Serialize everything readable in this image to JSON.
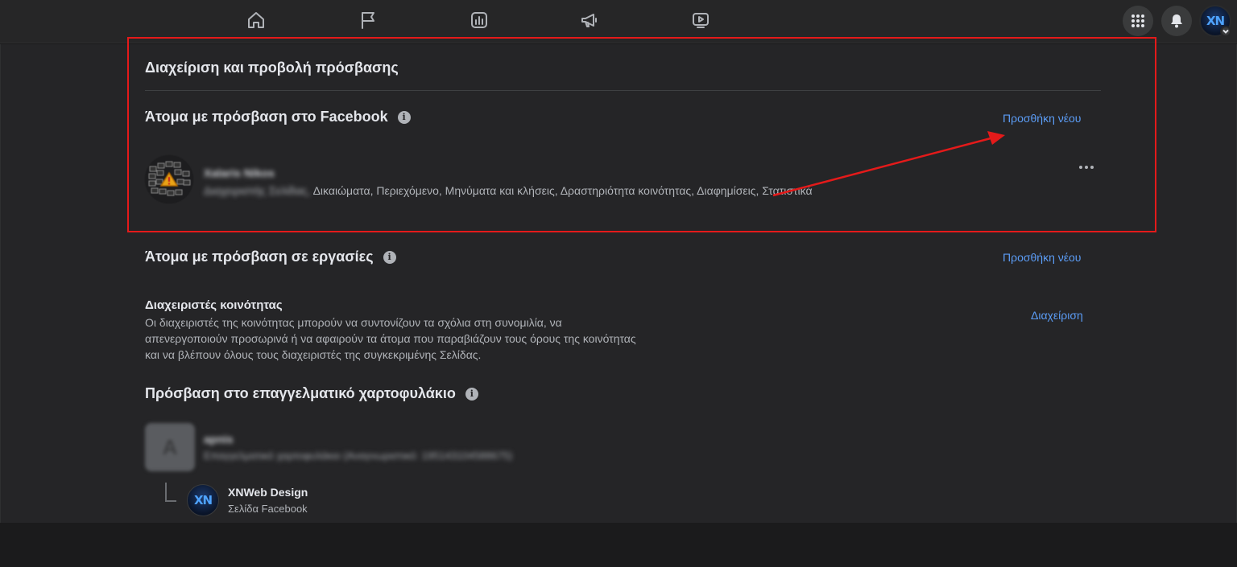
{
  "topbar": {
    "nav": [
      {
        "name": "home-icon"
      },
      {
        "name": "flag-icon"
      },
      {
        "name": "insights-icon"
      },
      {
        "name": "megaphone-icon"
      },
      {
        "name": "video-icon"
      }
    ],
    "menu_icon": "grid-menu-icon",
    "notifications_icon": "bell-icon",
    "profile_logo_text": "XN"
  },
  "access": {
    "title": "Διαχείριση και προβολή πρόσβασης",
    "facebook_access": {
      "title": "Άτομα με πρόσβαση στο Facebook",
      "add_label": "Προσθήκη νέου",
      "people": [
        {
          "name": "Xalaris Nikos",
          "role_blurred": "Διαχειριστής Σελίδας,",
          "permissions": " Δικαιώματα, Περιεχόμενο, Μηνύματα και κλήσεις, Δραστηριότητα κοινότητας, Διαφημίσεις, Στατιστικά"
        }
      ]
    },
    "task_access": {
      "title": "Άτομα με πρόσβαση σε εργασίες",
      "add_label": "Προσθήκη νέου"
    },
    "moderators": {
      "title": "Διαχειριστές κοινότητας",
      "description": "Οι διαχειριστές της κοινότητας μπορούν να συντονίζουν τα σχόλια στη συνομιλία, να απενεργοποιούν προσωρινά ή να αφαιρούν τα άτομα που παραβιάζουν τους όρους της κοινότητας και να βλέπουν όλους τους διαχειριστές της συγκεκριμένης Σελίδας.",
      "manage_label": "Διαχείριση"
    },
    "business_portfolio": {
      "title": "Πρόσβαση στο επαγγελματικό χαρτοφυλάκιο",
      "portfolio": {
        "initial": "A",
        "name": "apnis",
        "subtitle": "Επαγγελματικό χαρτοφυλάκιο (Αναγνωριστικό: 195143104588675)"
      },
      "page": {
        "logo_text": "XN",
        "name": "XNWeb Design",
        "subtitle": "Σελίδα Facebook"
      }
    }
  },
  "colors": {
    "highlight": "#e41a1a",
    "link": "#5b9cf5"
  }
}
